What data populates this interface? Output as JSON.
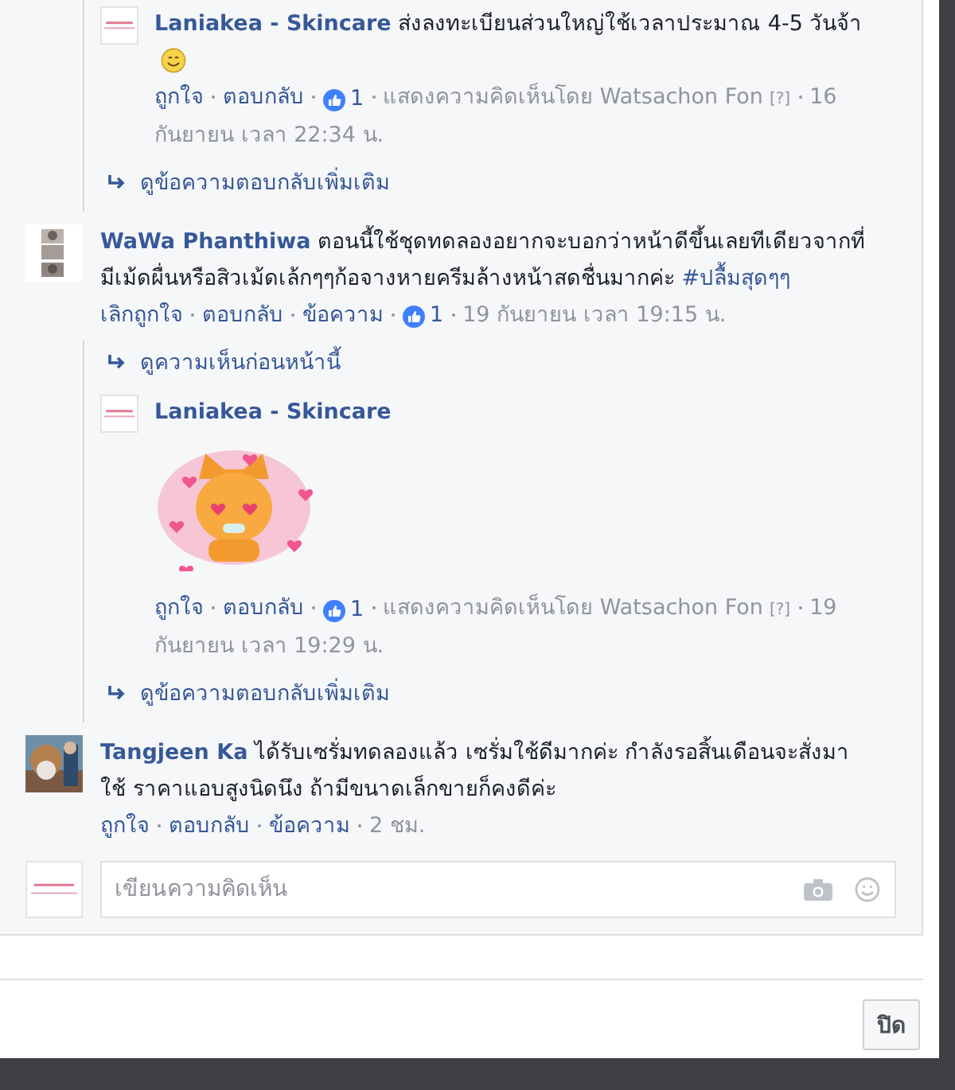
{
  "thread": [
    {
      "kind": "replies",
      "children": [
        {
          "kind": "reply",
          "avatar": {
            "kind": "logo"
          },
          "author": "Laniakea - Skincare",
          "text": "ส่งลงทะเบียนส่วนใหญ่ใช้เวลาประมาณ 4-5 วันจ้า",
          "smiley": true,
          "actions": [
            {
              "kind": "link",
              "text": "ถูกใจ"
            },
            {
              "kind": "link",
              "text": "ตอบกลับ"
            },
            {
              "kind": "likes",
              "text": "1"
            },
            {
              "kind": "meta",
              "text": "แสดงความคิดเห็นโดย Watsachon Fon",
              "help": "[?]"
            },
            {
              "kind": "meta",
              "text": "16 กันยายน เวลา 22:34 น."
            }
          ]
        },
        {
          "kind": "more",
          "text": "ดูข้อความตอบกลับเพิ่มเติม"
        }
      ]
    },
    {
      "kind": "comment",
      "author": "WaWa Phanthiwa",
      "text": "ตอนนี้ใช้ชุดทดลองอยากจะบอกว่าหน้าดีขึ้นเลยทีเดียวจากที่มีเม้ดผื่นหรือสิวเม้ดเล้กๆๆก้อจางหายครีมล้างหน้าสดชื่นมากค่ะ",
      "tag": "#ปลื้มสุดๆๆ",
      "actions": [
        {
          "kind": "link",
          "text": "เลิกถูกใจ"
        },
        {
          "kind": "link",
          "text": "ตอบกลับ"
        },
        {
          "kind": "link",
          "text": "ข้อความ"
        },
        {
          "kind": "likes",
          "text": "1"
        },
        {
          "kind": "meta",
          "text": "19 กันยายน เวลา 19:15 น."
        }
      ]
    },
    {
      "kind": "replies",
      "children": [
        {
          "kind": "more",
          "text": "ดูความเห็นก่อนหน้านี้"
        },
        {
          "kind": "reply",
          "avatar": {
            "kind": "logo"
          },
          "author": "Laniakea - Skincare",
          "sticker": true,
          "actions": [
            {
              "kind": "link",
              "text": "ถูกใจ"
            },
            {
              "kind": "link",
              "text": "ตอบกลับ"
            },
            {
              "kind": "likes",
              "text": "1"
            },
            {
              "kind": "meta",
              "text": "แสดงความคิดเห็นโดย Watsachon Fon",
              "help": "[?]"
            },
            {
              "kind": "meta",
              "text": "19 กันยายน เวลา 19:29 น."
            }
          ]
        },
        {
          "kind": "more",
          "text": "ดูข้อความตอบกลับเพิ่มเติม"
        }
      ]
    },
    {
      "kind": "comment",
      "avatar": {
        "kind": "photo2"
      },
      "author": "Tangjeen Ka",
      "text": "ได้รับเซรั่มทดลองแล้ว เซรั่มใช้ดีมากค่ะ กำลังรอสิ้นเดือนจะสั่งมาใช้ ราคาแอบสูงนิดนึง ถ้ามีขนาดเล็กขายก็คงดีค่ะ",
      "actions": [
        {
          "kind": "link",
          "text": "ถูกใจ"
        },
        {
          "kind": "link",
          "text": "ตอบกลับ"
        },
        {
          "kind": "link",
          "text": "ข้อความ"
        },
        {
          "kind": "meta",
          "text": "2 ชม."
        }
      ]
    }
  ],
  "composer": {
    "avatar": {
      "kind": "logo"
    },
    "placeholder": "เขียนความคิดเห็น"
  },
  "close_button": "ปิด"
}
